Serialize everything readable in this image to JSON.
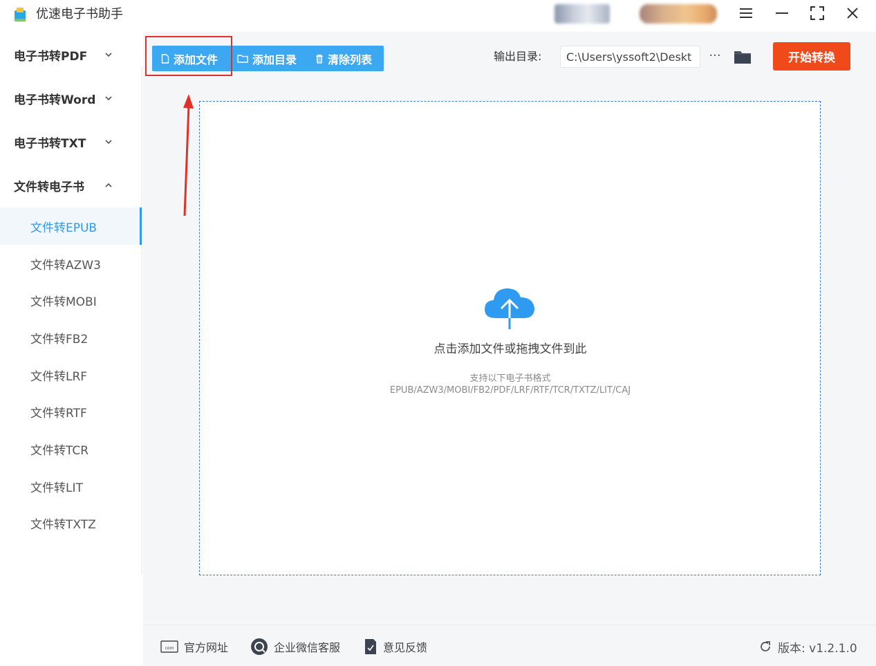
{
  "app": {
    "title": "优速电子书助手"
  },
  "sidebar": {
    "categories": [
      {
        "label": "电子书转PDF",
        "expanded": false
      },
      {
        "label": "电子书转Word",
        "expanded": false
      },
      {
        "label": "电子书转TXT",
        "expanded": false
      },
      {
        "label": "文件转电子书",
        "expanded": true
      }
    ],
    "items": [
      {
        "label": "文件转EPUB",
        "active": true
      },
      {
        "label": "文件转AZW3"
      },
      {
        "label": "文件转MOBI"
      },
      {
        "label": "文件转FB2"
      },
      {
        "label": "文件转LRF"
      },
      {
        "label": "文件转RTF"
      },
      {
        "label": "文件转TCR"
      },
      {
        "label": "文件转LIT"
      },
      {
        "label": "文件转TXTZ"
      }
    ]
  },
  "toolbar": {
    "add_file": "添加文件",
    "add_dir": "添加目录",
    "clear_list": "清除列表",
    "output_label": "输出目录:",
    "output_path": "C:\\Users\\yssoft2\\Deskt",
    "more": "···",
    "start": "开始转换"
  },
  "dropzone": {
    "hint": "点击添加文件或拖拽文件到此",
    "formats_title": "支持以下电子书格式",
    "formats": "EPUB/AZW3/MOBI/FB2/PDF/LRF/RTF/TCR/TXTZ/LIT/CAJ"
  },
  "footer": {
    "website": "官方网址",
    "wechat": "企业微信客服",
    "feedback": "意见反馈",
    "version": "版本: v1.2.1.0"
  },
  "colors": {
    "accent": "#3ba8f1",
    "active_text": "#2f9bf0",
    "start_button": "#f04a1b",
    "annotation": "#e03127",
    "dropzone_border": "#3d7ac9"
  },
  "icons": {
    "titlebar": [
      "menu-icon",
      "minimize-icon",
      "maximize-icon",
      "close-icon"
    ],
    "toolbar": [
      "file-icon",
      "folder-outline-icon",
      "trash-icon",
      "folder-icon"
    ],
    "dropzone": "cloud-upload-icon",
    "footer": [
      "website-icon",
      "chat-icon",
      "feedback-icon",
      "refresh-icon"
    ]
  }
}
